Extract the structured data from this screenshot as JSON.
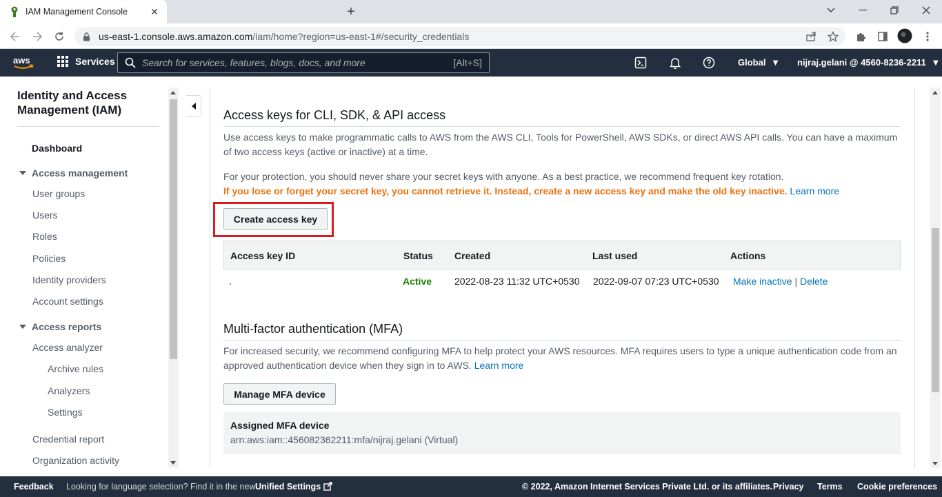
{
  "browser": {
    "tab_title": "IAM Management Console",
    "url_host": "us-east-1.console.aws.amazon.com",
    "url_path": "/iam/home?region=us-east-1#/security_credentials"
  },
  "aws_nav": {
    "services_label": "Services",
    "search_placeholder": "Search for services, features, blogs, docs, and more",
    "search_shortcut": "[Alt+S]",
    "region": "Global",
    "account": "nijraj.gelani @ 4560-8236-2211"
  },
  "sidebar": {
    "title": "Identity and Access Management (IAM)",
    "dashboard": "Dashboard",
    "access_management": "Access management",
    "user_groups": "User groups",
    "users": "Users",
    "roles": "Roles",
    "policies": "Policies",
    "identity_providers": "Identity providers",
    "account_settings": "Account settings",
    "access_reports": "Access reports",
    "access_analyzer": "Access analyzer",
    "archive_rules": "Archive rules",
    "analyzers": "Analyzers",
    "settings": "Settings",
    "credential_report": "Credential report",
    "organization_activity": "Organization activity"
  },
  "access_keys": {
    "heading": "Access keys for CLI, SDK, & API access",
    "description": "Use access keys to make programmatic calls to AWS from the AWS CLI, Tools for PowerShell, AWS SDKs, or direct AWS API calls. You can have a maximum of two access keys (active or inactive) at a time.",
    "protection_text": "For your protection, you should never share your secret keys with anyone. As a best practice, we recommend frequent key rotation.",
    "warning_text": "If you lose or forget your secret key, you cannot retrieve it. Instead, create a new access key and make the old key inactive.",
    "learn_more": "Learn more",
    "create_button": "Create access key",
    "columns": {
      "key_id": "Access key ID",
      "status": "Status",
      "created": "Created",
      "last_used": "Last used",
      "actions": "Actions"
    },
    "row": {
      "key_id": ".",
      "status": "Active",
      "created": "2022-08-23 11:32 UTC+0530",
      "last_used": "2022-09-07 07:23 UTC+0530",
      "make_inactive": "Make inactive",
      "separator": "|",
      "delete": "Delete"
    }
  },
  "mfa": {
    "heading": "Multi-factor authentication (MFA)",
    "description": "For increased security, we recommend configuring MFA to help protect your AWS resources. MFA requires users to type a unique authentication code from an approved authentication device when they sign in to AWS.",
    "learn_more": "Learn more",
    "manage_button": "Manage MFA device",
    "assigned_label": "Assigned MFA device",
    "assigned_value": "arn:aws:iam::456082362211:mfa/nijraj.gelani (Virtual)"
  },
  "footer": {
    "feedback": "Feedback",
    "language_text": "Looking for language selection? Find it in the new",
    "unified_settings": "Unified Settings",
    "copyright": "© 2022, Amazon Internet Services Private Ltd. or its affiliates.",
    "privacy": "Privacy",
    "terms": "Terms",
    "cookie_preferences": "Cookie preferences"
  },
  "colors": {
    "aws_nav_bg": "#232f3e",
    "link": "#0073bb",
    "warning": "#ec7211",
    "active": "#1d8102",
    "highlight_box": "#e0191e"
  }
}
